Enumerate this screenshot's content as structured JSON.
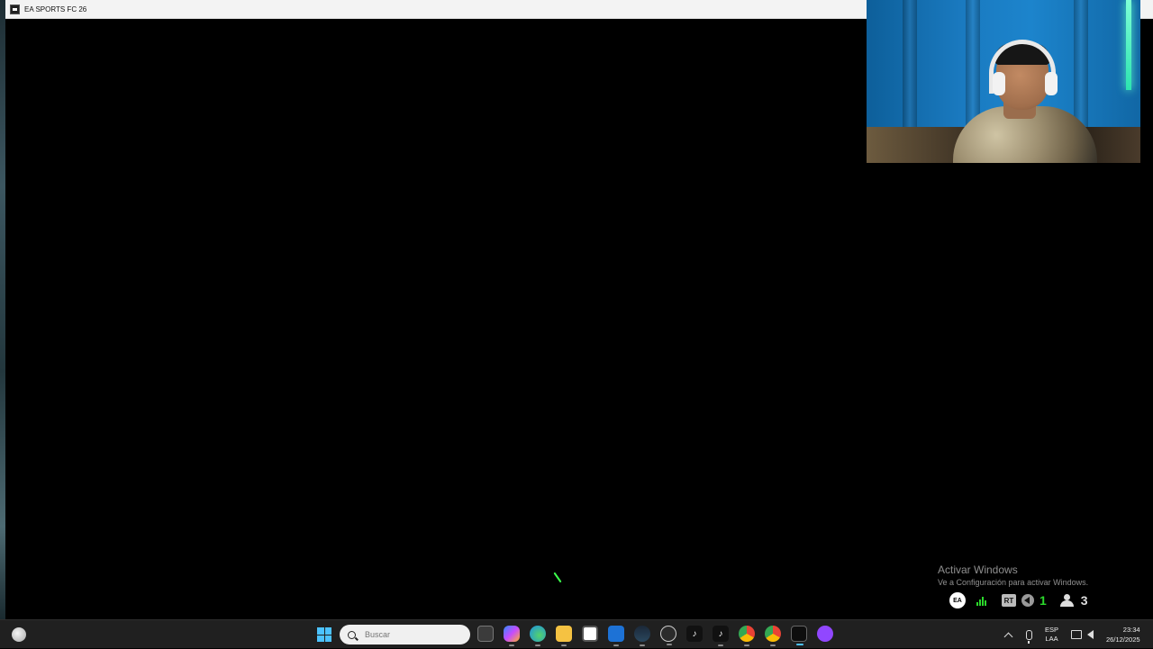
{
  "window": {
    "title": "EA SPORTS FC 26"
  },
  "watermark": {
    "title": "Activar Windows",
    "subtitle": "Ve a Configuración para activar Windows."
  },
  "overlay": {
    "ea_label": "EA",
    "rt_label": "RT",
    "count_green": "1",
    "count_players": "3"
  },
  "taskbar": {
    "search_placeholder": "Buscar",
    "apps": [
      {
        "icon": "task-view-icon"
      },
      {
        "icon": "copilot-icon"
      },
      {
        "icon": "edge-icon"
      },
      {
        "icon": "file-explorer-icon"
      },
      {
        "icon": "microsoft-store-icon"
      },
      {
        "icon": "outlook-icon"
      },
      {
        "icon": "steam-icon"
      },
      {
        "icon": "app-icon"
      },
      {
        "icon": "tiktok-icon"
      },
      {
        "icon": "tiktok-live-icon"
      },
      {
        "icon": "chrome-icon"
      },
      {
        "icon": "chrome-profile-icon"
      },
      {
        "icon": "ea-fc-icon"
      },
      {
        "icon": "twitch-icon"
      }
    ],
    "tray": {
      "lang_line1": "ESP",
      "lang_line2": "LAA",
      "time": "23:34",
      "date": "26/12/2025"
    }
  },
  "colors": {
    "taskbar_bg": "#202020",
    "accent": "#4cc2ff",
    "stat_green": "#2bd92b"
  }
}
